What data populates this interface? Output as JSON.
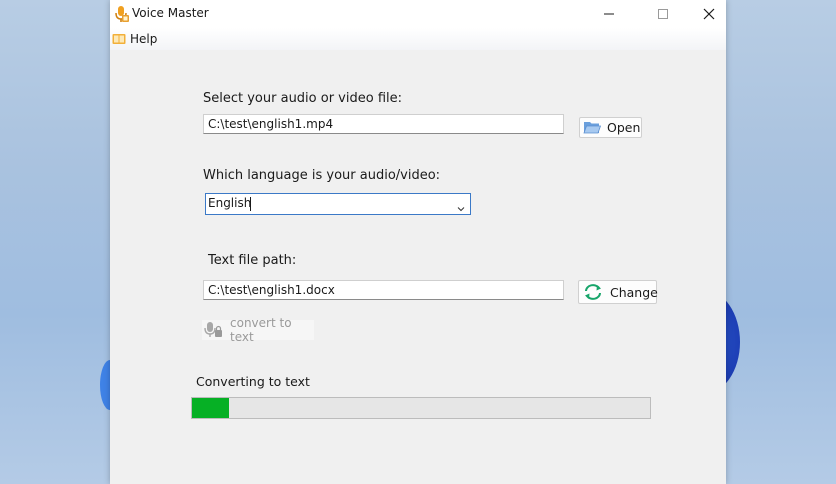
{
  "window": {
    "title": "Voice Master"
  },
  "menu": {
    "help_label": "Help"
  },
  "file_select": {
    "label": "Select your audio or video file:",
    "value": "C:\\test\\english1.mp4",
    "open_label": "Open"
  },
  "language": {
    "label": "Which language is your audio/video:",
    "selected": "English"
  },
  "output": {
    "label": "Text file path:",
    "value": "C:\\test\\english1.docx",
    "change_label": "Change"
  },
  "convert": {
    "label": "convert to text",
    "enabled": false
  },
  "progress": {
    "label": "Converting to text",
    "fraction": 0.08,
    "color": "#06b025"
  },
  "icons": {
    "app": "microphone-icon",
    "help": "book-icon",
    "open": "folder-icon",
    "change": "refresh-arrows-icon",
    "convert": "microphone-lock-icon"
  }
}
